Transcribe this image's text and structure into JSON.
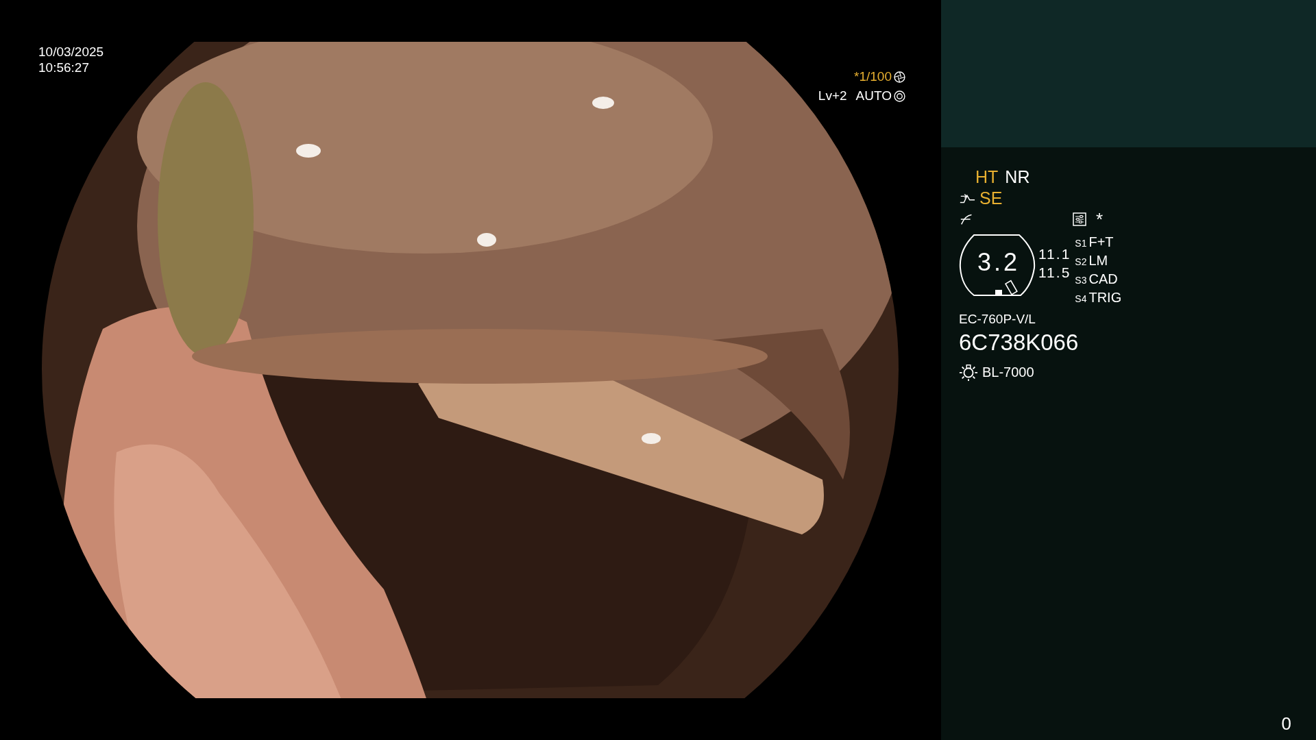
{
  "datetime": {
    "date": "10/03/2025",
    "time": "10:56:27"
  },
  "exposure": {
    "shutter": "*1/100",
    "level": "Lv+2",
    "mode": "AUTO"
  },
  "panel": {
    "modes": [
      {
        "label": "HT",
        "highlighted": true
      },
      {
        "label": "NR",
        "highlighted": false
      }
    ],
    "enhancement": {
      "label": "SE",
      "highlighted": true
    },
    "marker": "*",
    "gauge": "3.2",
    "readings": [
      "11.1",
      "11.5"
    ],
    "switches": [
      {
        "key": "S1",
        "value": "F+T"
      },
      {
        "key": "S2",
        "value": "LM"
      },
      {
        "key": "S3",
        "value": "CAD"
      },
      {
        "key": "S4",
        "value": "TRIG"
      }
    ],
    "model": "EC-760P-V/L",
    "serial": "6C738K066",
    "light": "BL-7000"
  },
  "counter": "0"
}
